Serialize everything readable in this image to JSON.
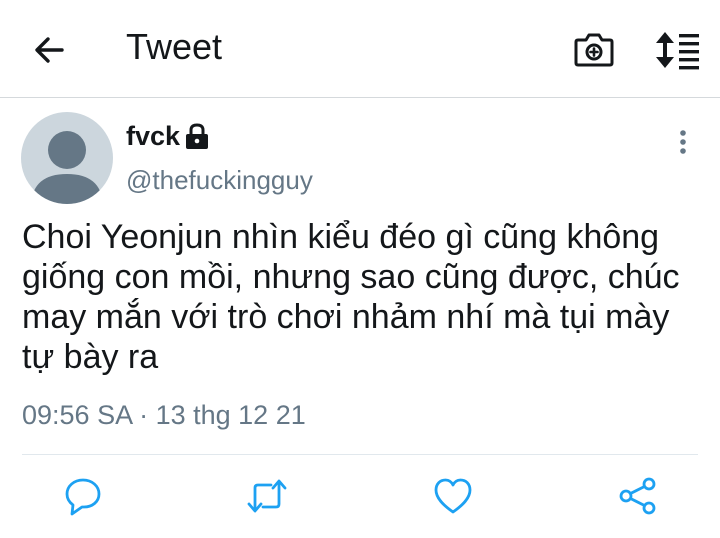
{
  "header": {
    "title": "Tweet",
    "back_icon": "arrow-left-icon",
    "camera_icon": "camera-plus-icon",
    "sort_icon": "sort-icon"
  },
  "tweet": {
    "display_name": "fvck",
    "protected_icon": "lock-icon",
    "handle": "@thefuckingguy",
    "text": "Choi Yeonjun nhìn kiểu đéo gì cũng không giống con mồi, nhưng sao cũng được, chúc may mắn với trò chơi nhảm nhí mà tụi mày tự bày ra",
    "timestamp": "09:56 SA · 13 thg 12 21"
  },
  "actions": [
    {
      "name": "reply",
      "icon": "reply-icon"
    },
    {
      "name": "retweet",
      "icon": "retweet-icon"
    },
    {
      "name": "like",
      "icon": "heart-icon"
    },
    {
      "name": "share",
      "icon": "share-icon"
    }
  ],
  "colors": {
    "text": "#14171a",
    "secondary": "#657786",
    "icon": "#1da1f2",
    "avatar_bg": "#ccd6dd",
    "avatar_fg": "#657786"
  }
}
